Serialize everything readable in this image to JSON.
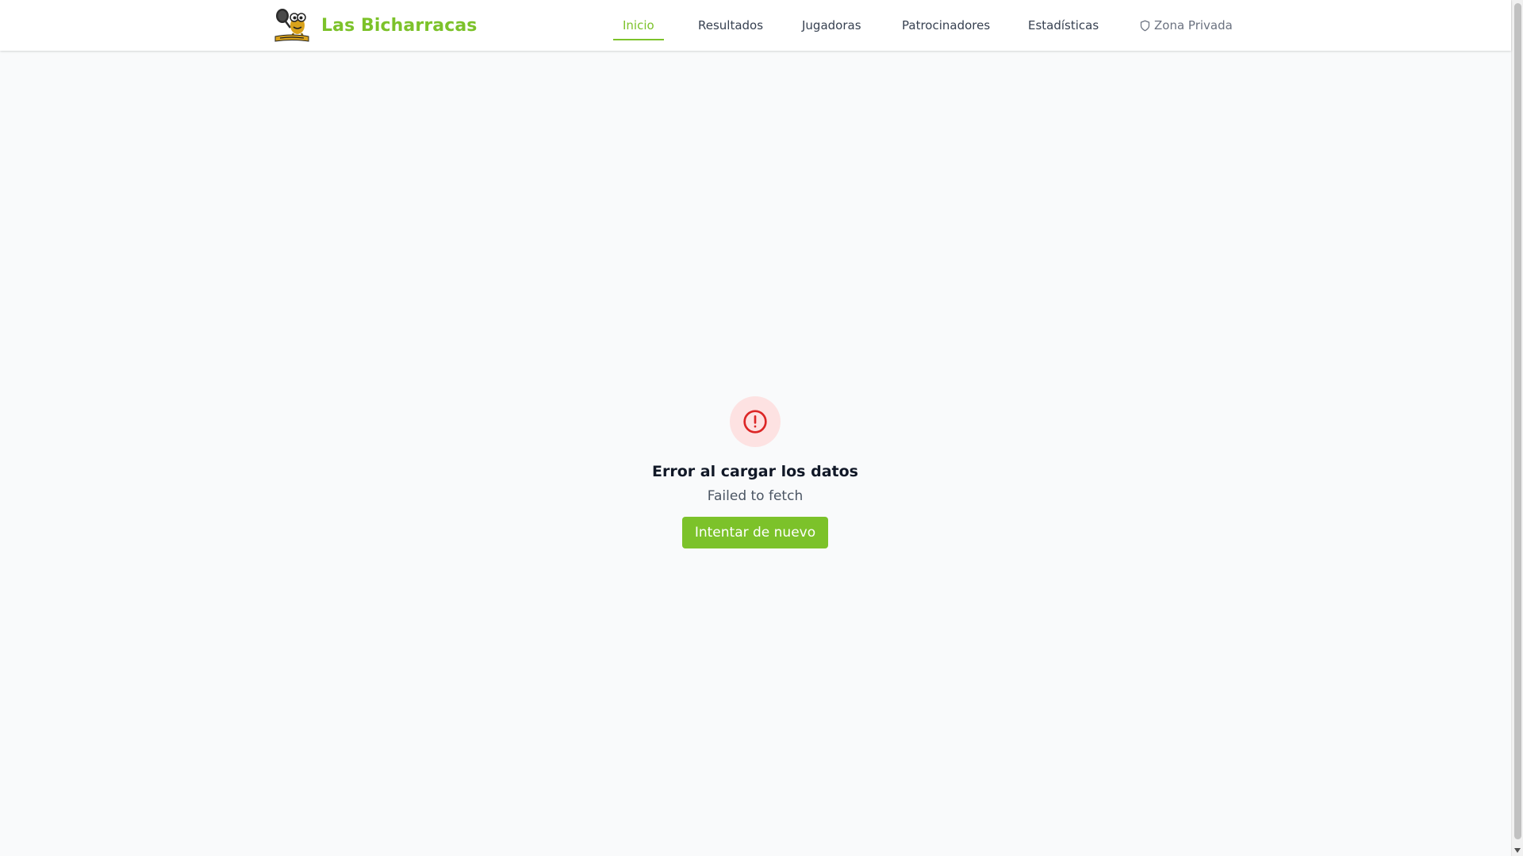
{
  "brand": {
    "name": "Las Bicharracas",
    "logo_icon": "bicharracas-mascot-logo"
  },
  "nav": {
    "items": [
      {
        "label": "Inicio",
        "active": true
      },
      {
        "label": "Resultados",
        "active": false
      },
      {
        "label": "Jugadoras",
        "active": false
      },
      {
        "label": "Patrocinadores",
        "active": false
      },
      {
        "label": "Estadísticas",
        "active": false
      }
    ],
    "private": {
      "label": "Zona Privada",
      "icon": "shield-icon"
    }
  },
  "error": {
    "icon": "alert-circle-icon",
    "title": "Error al cargar los datos",
    "message": "Failed to fetch",
    "retry_label": "Intentar de nuevo"
  },
  "colors": {
    "accent": "#7cc22a",
    "error_red": "#dc2626",
    "error_bg": "#fde2e2",
    "page_bg": "#f9fafb"
  }
}
